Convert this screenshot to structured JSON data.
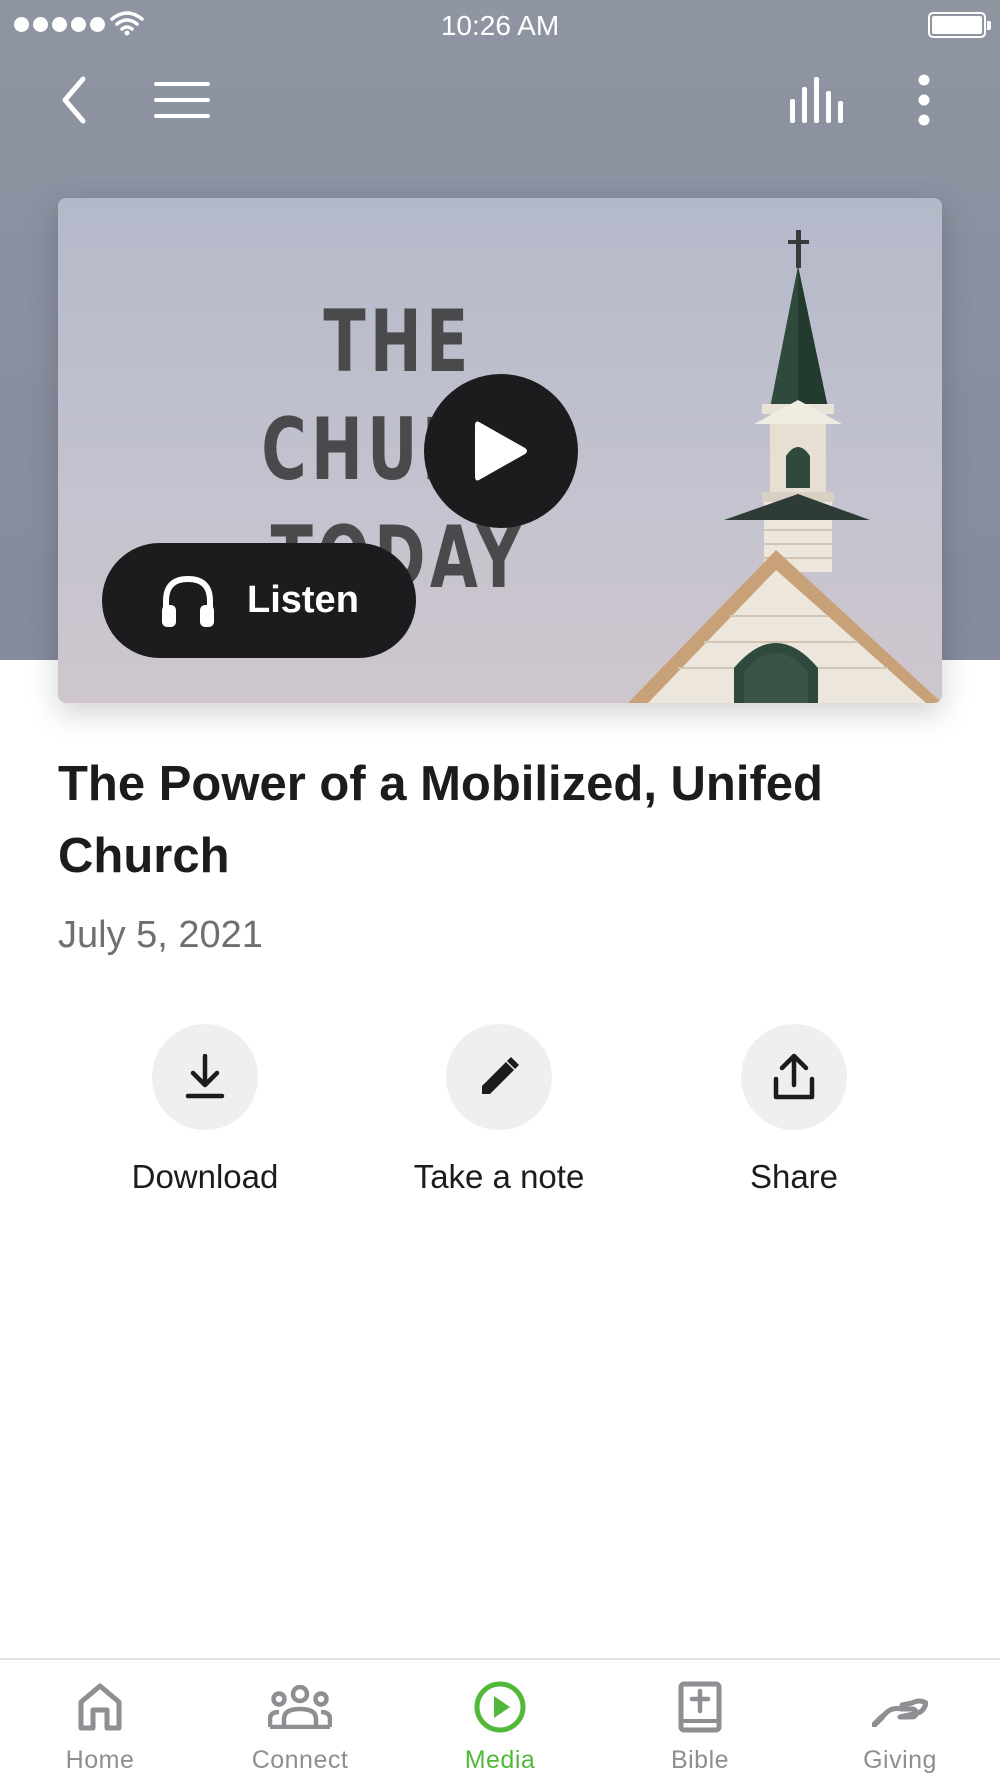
{
  "status_bar": {
    "time": "10:26 AM"
  },
  "nav": {
    "back_icon": "chevron-left-icon",
    "menu_icon": "hamburger-icon",
    "audio_icon": "equalizer-icon",
    "more_icon": "more-vertical-icon"
  },
  "media": {
    "artwork_lines": [
      "THE",
      "CHURCH",
      "TODAY"
    ],
    "play_icon": "play-icon",
    "listen_label": "Listen",
    "listen_icon": "headphones-icon"
  },
  "sermon": {
    "title": "The Power of a Mobilized, Unifed Church",
    "date": "July 5, 2021"
  },
  "actions": [
    {
      "label": "Download",
      "icon": "download-icon"
    },
    {
      "label": "Take a note",
      "icon": "pencil-icon"
    },
    {
      "label": "Share",
      "icon": "share-icon"
    }
  ],
  "tabs": [
    {
      "label": "Home",
      "icon": "home-icon",
      "active": false
    },
    {
      "label": "Connect",
      "icon": "people-icon",
      "active": false
    },
    {
      "label": "Media",
      "icon": "play-circle-icon",
      "active": true
    },
    {
      "label": "Bible",
      "icon": "bible-icon",
      "active": false
    },
    {
      "label": "Giving",
      "icon": "giving-hand-icon",
      "active": false
    }
  ],
  "colors": {
    "accent": "#52b83a",
    "header_bg": "#8a90a0",
    "dark": "#1c1c1e"
  }
}
